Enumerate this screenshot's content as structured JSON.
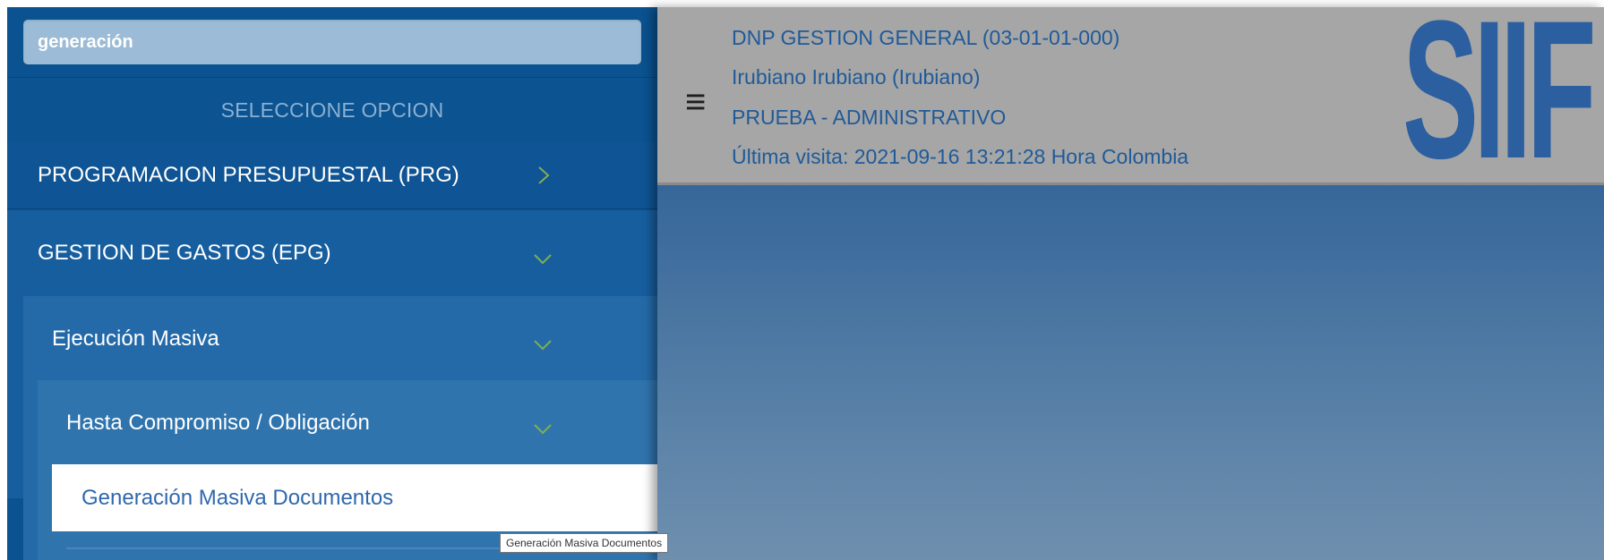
{
  "search": {
    "value": "generación"
  },
  "menu": {
    "select_option_label": "SELECCIONE OPCION",
    "items": [
      {
        "label": "PROGRAMACION PRESUPUESTAL (PRG)",
        "icon": "chevron-right-icon",
        "expanded": false
      },
      {
        "label": "GESTION DE GASTOS (EPG)",
        "icon": "chevron-down-icon",
        "expanded": true
      }
    ],
    "sub": {
      "label": "Ejecución Masiva",
      "icon": "chevron-down-icon"
    },
    "subsub": {
      "label": "Hasta Compromiso / Obligación",
      "icon": "chevron-down-icon"
    },
    "active_item": {
      "label": "Generación Masiva Documentos"
    },
    "tooltip": "Generación Masiva Documentos"
  },
  "header": {
    "menu_icon": "hamburger-icon",
    "entity": "DNP GESTION GENERAL (03-01-01-000)",
    "user": "Irubiano Irubiano (Irubiano)",
    "profile": "PRUEBA - ADMINISTRATIVO",
    "last_visit": "Última visita: 2021-09-16 13:21:28 Hora Colombia",
    "logo_text": "SIIF"
  },
  "colors": {
    "sidebar_bg": "#0a5290",
    "header_bg": "#a6a6a6",
    "header_text": "#1f5a99",
    "chevron": "#7fb04e",
    "active_text": "#2f68ad"
  }
}
